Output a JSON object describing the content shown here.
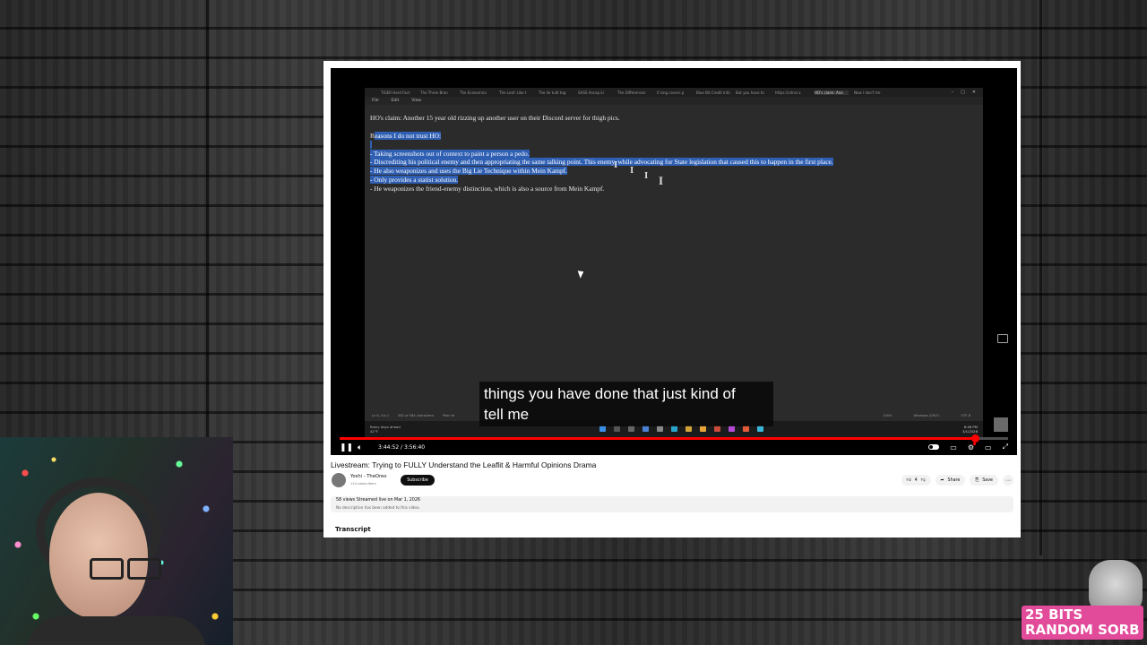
{
  "inner_browser": {
    "tabs": [
      "TIGER Hard Fact",
      "The Three Bran",
      "The Economics",
      "The Leaf. Like t",
      "The lie tulit tog",
      "SASS Ancap ki",
      "The Differences",
      "if sing covers p",
      "Blue Bit Credit Info",
      "But you have to",
      "https://cdnsr.x",
      "HO's claim: Ano",
      "Now I don't tre"
    ],
    "active_tab_index": 11,
    "menu": [
      "File",
      "Edit",
      "View"
    ],
    "window_controls": [
      "–",
      "□",
      "✕"
    ]
  },
  "document": {
    "heading": "HO's claim: Another 15 year old rizzing up another user on their Discord server for thigh pics.",
    "reasons_prefix": "R",
    "reasons_rest": "easons I do not trust HO:",
    "items": [
      {
        "text": "- Taking screenshots out of context to paint a person a pedo.",
        "selected": true
      },
      {
        "text": "- Discrediting his political enemy and then appropriating the same talking point. This enemy, while advocating for State legislation that caused this to happen in the first place.",
        "selected": true
      },
      {
        "text": "- He also weaponizes and uses the Big Lie Technique within Mein Kampf.",
        "selected": true
      },
      {
        "text": "- Only provides a statist solution.",
        "selected": true
      },
      {
        "text": "- He weaponizes the friend-enemy distinction, which is also a source from Mein Kampf.",
        "selected": false
      }
    ]
  },
  "statusbar": {
    "position": "Ln 6, Col 1",
    "chars": "582 of 584 characters",
    "mode": "Plain te",
    "zoom": "100%",
    "line_ending": "Windows (CRLF)",
    "encoding": "UTF-8"
  },
  "taskbar": {
    "weather_line1": "Rainy days ahead",
    "weather_line2": "42°F",
    "clock_time": "6:46 PM",
    "clock_date": "3/1/2026"
  },
  "caption": {
    "line1": "things you have done that just kind of",
    "line2": "tell me"
  },
  "player": {
    "time": "3:44:52 / 3:56:40",
    "progress": 0.95,
    "colors": {
      "progress": "#ff0000",
      "caption_bg": "#080808"
    }
  },
  "video": {
    "title": "Livestream: Trying to FULLY Understand the Leaflit & Harmful Opinions Drama",
    "channel": "Yoshi - TheOreo",
    "subs": "114 subscribers",
    "subscribe_label": "Subscribe",
    "likes": "4",
    "share_label": "Share",
    "save_label": "Save",
    "stats": "58 views  Streamed live on Mar 1, 2026",
    "description": "No description has been added to this video.",
    "transcript_label": "Transcript"
  },
  "bits_alert": {
    "line1": "25 BITS",
    "line2": "RANDOM SORB",
    "color": "#e24a9a"
  }
}
